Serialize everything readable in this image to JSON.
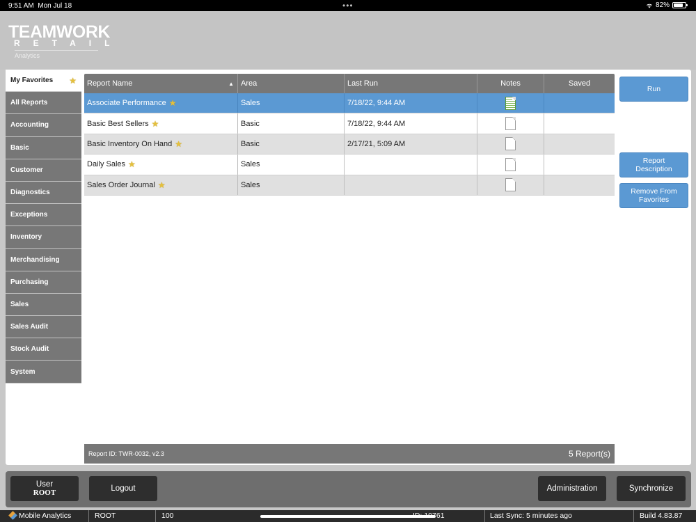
{
  "status_bar": {
    "time": "9:51 AM",
    "date": "Mon Jul 18",
    "battery": "82%",
    "battery_level": 0.82
  },
  "logo": {
    "line1": "TEAMWORK",
    "line2": "RETAIL",
    "line3": "Analytics"
  },
  "sidebar": {
    "items": [
      {
        "label": "My Favorites",
        "active": true
      },
      {
        "label": "All Reports"
      },
      {
        "label": "Accounting"
      },
      {
        "label": "Basic"
      },
      {
        "label": "Customer"
      },
      {
        "label": "Diagnostics"
      },
      {
        "label": "Exceptions"
      },
      {
        "label": "Inventory"
      },
      {
        "label": "Merchandising"
      },
      {
        "label": "Purchasing"
      },
      {
        "label": "Sales"
      },
      {
        "label": "Sales Audit"
      },
      {
        "label": "Stock Audit"
      },
      {
        "label": "System"
      }
    ]
  },
  "table": {
    "columns": [
      "Report Name",
      "Area",
      "Last Run",
      "Notes",
      "Saved"
    ],
    "sort_indicator": "▲",
    "rows": [
      {
        "name": "Associate Performance",
        "area": "Sales",
        "last_run": "7/18/22, 9:44 AM",
        "selected": true,
        "note": "green"
      },
      {
        "name": "Basic Best Sellers",
        "area": "Basic",
        "last_run": "7/18/22, 9:44 AM",
        "note": "blank"
      },
      {
        "name": "Basic Inventory On Hand",
        "area": "Basic",
        "last_run": "2/17/21, 5:09 AM",
        "note": "blank"
      },
      {
        "name": "Daily Sales",
        "area": "Sales",
        "last_run": "",
        "note": "blank"
      },
      {
        "name": "Sales Order Journal",
        "area": "Sales",
        "last_run": "",
        "note": "blank"
      }
    ]
  },
  "info_bar": {
    "report_id": "Report ID: TWR-0032, v2.3",
    "report_count": "5 Report(s)"
  },
  "actions": {
    "run": "Run",
    "report_description": "Report Description",
    "remove_favorites": "Remove From Favorites"
  },
  "toolbar": {
    "user_label": "User",
    "user_name": "ROOT",
    "logout": "Logout",
    "administration": "Administration",
    "synchronize": "Synchronize"
  },
  "bottom_status": {
    "app_name": "Mobile Analytics",
    "user": "ROOT",
    "location": "100",
    "device_id": "ID: 10761",
    "last_sync": "Last Sync: 5 minutes ago",
    "build": "Build 4.83.87"
  },
  "colors": {
    "accent_blue": "#5b99d3",
    "header_gray": "#777777",
    "star_gold": "#e5c03c"
  }
}
